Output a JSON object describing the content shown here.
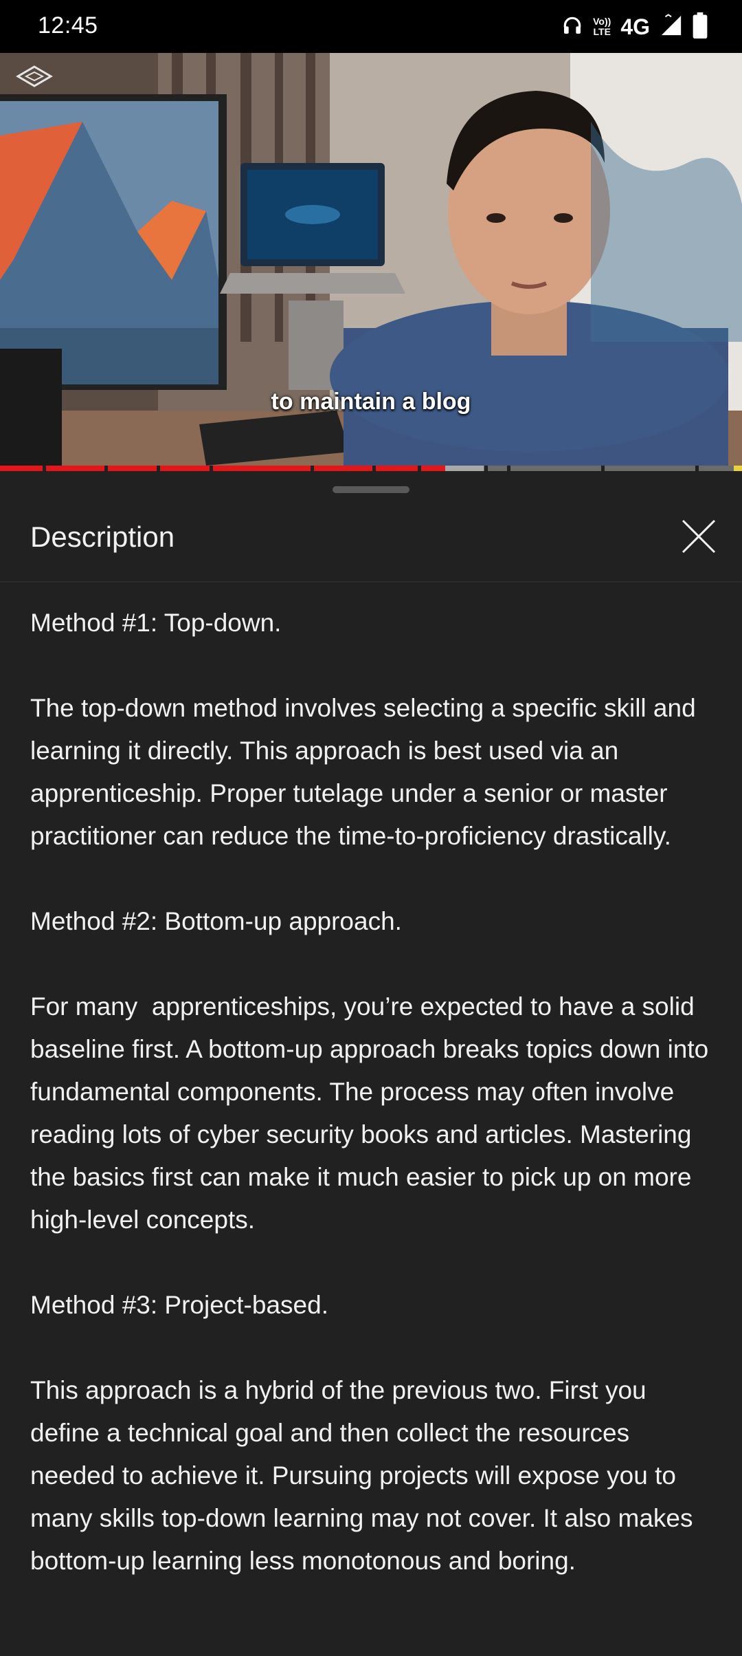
{
  "status_bar": {
    "time": "12:45",
    "network": "4G",
    "volte_line1": "Vo))",
    "volte_line2": "LTE",
    "icons": [
      "headphones-icon",
      "volte-icon",
      "signal-icon",
      "battery-icon"
    ]
  },
  "video": {
    "caption": "to maintain a blog",
    "progress_fraction": 0.6
  },
  "sheet": {
    "title": "Description",
    "close_icon": "close-icon"
  },
  "description": {
    "paragraphs": [
      "Method #1: Top-down.",
      "The top-down method involves selecting a specific skill and learning it directly. This approach is best used via an apprenticeship. Proper tutelage under a senior or master practitioner can reduce the time-to-proficiency drastically.",
      "Method #2: Bottom-up approach.",
      "For many  apprenticeships, you’re expected to have a solid baseline first. A bottom-up approach breaks topics down into fundamental components. The process may often involve reading lots of cyber security books and articles. Mastering the basics first can make it much easier to pick up on more high-level concepts.",
      "Method #3: Project-based.",
      "This approach is a hybrid of the previous two. First you define a technical goal and then collect the resources needed to achieve it. Pursuing projects will expose you to many skills top-down learning may not cover. It also makes bottom-up learning less monotonous and boring."
    ]
  },
  "colors": {
    "sheet_bg": "#212121",
    "progress_played": "#e4161a",
    "text": "#f1f1f1"
  }
}
